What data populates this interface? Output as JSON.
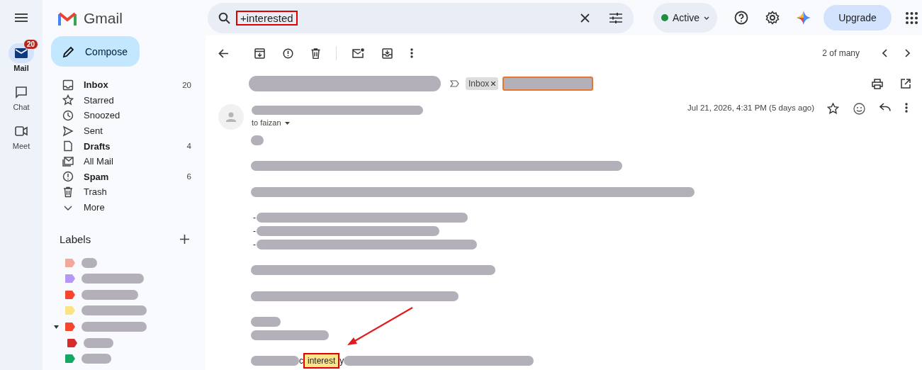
{
  "app": {
    "name": "Gmail"
  },
  "rail": [
    {
      "label": "Mail",
      "selected": true,
      "badge": "20"
    },
    {
      "label": "Chat",
      "selected": false
    },
    {
      "label": "Meet",
      "selected": false
    }
  ],
  "compose": {
    "label": "Compose"
  },
  "folders": [
    {
      "label": "Inbox",
      "unread": true,
      "count": "20"
    },
    {
      "label": "Starred",
      "unread": false
    },
    {
      "label": "Snoozed",
      "unread": false
    },
    {
      "label": "Sent",
      "unread": false
    },
    {
      "label": "Drafts",
      "unread": true,
      "count": "4"
    },
    {
      "label": "All Mail",
      "unread": false
    },
    {
      "label": "Spam",
      "unread": true,
      "count": "6"
    },
    {
      "label": "Trash",
      "unread": false
    },
    {
      "label": "More",
      "unread": false
    }
  ],
  "labels": {
    "title": "Labels",
    "items": [
      {
        "color": "#f2a99b"
      },
      {
        "color": "#b597f5"
      },
      {
        "color": "#f4472d"
      },
      {
        "color": "#fbe383"
      },
      {
        "color": "#f4472d",
        "expanded": true,
        "children": [
          {
            "color": "#d52c2c"
          }
        ]
      },
      {
        "color": "#16a765"
      }
    ]
  },
  "search": {
    "value": "+interested",
    "annotated": true
  },
  "status": {
    "label": "Active",
    "color": "#1e8e3e"
  },
  "upgrade": {
    "label": "Upgrade"
  },
  "pager": {
    "text": "2 of many"
  },
  "message": {
    "chip": "Inbox",
    "date": "Jul 21, 2026, 4:31 PM (5 days ago)",
    "to": "to faizan",
    "body": [
      {
        "kind": "redacted"
      },
      {
        "kind": "redacted"
      },
      {
        "kind": "redacted"
      },
      {
        "kind": "bullet",
        "marker": "-"
      },
      {
        "kind": "bullet",
        "marker": "-"
      },
      {
        "kind": "bullet",
        "marker": "-"
      },
      {
        "kind": "redacted"
      },
      {
        "kind": "redacted"
      },
      {
        "kind": "redacted"
      },
      {
        "kind": "redacted"
      },
      {
        "kind": "match",
        "before": "c",
        "highlight": "interest",
        "after": "y",
        "annotated": true
      }
    ]
  }
}
